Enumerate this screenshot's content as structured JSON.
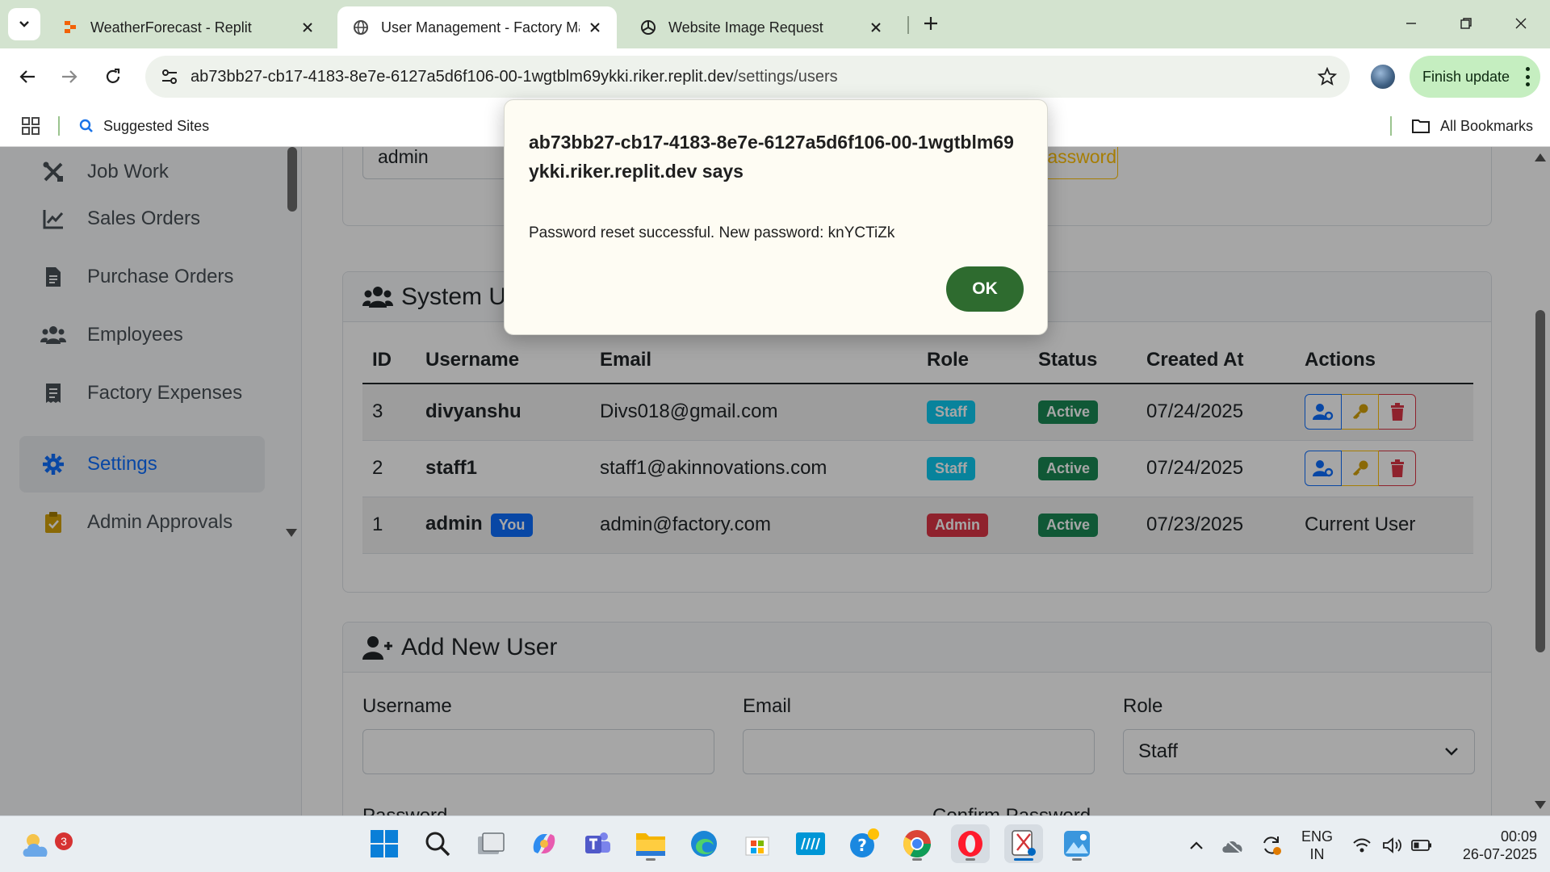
{
  "browser": {
    "tabs": [
      {
        "title": "WeatherForecast - Replit",
        "active": false
      },
      {
        "title": "User Management - Factory Ma",
        "active": true
      },
      {
        "title": "Website Image Request",
        "active": false
      }
    ],
    "url_host": "ab73bb27-cb17-4183-8e7e-6127a5d6f106-00-1wgtblm69ykki.riker.replit.dev",
    "url_path": "/settings/users",
    "finish_update_label": "Finish update",
    "bookmarks": {
      "suggested_sites": "Suggested Sites",
      "all_bookmarks": "All Bookmarks"
    }
  },
  "sidebar": {
    "items": [
      {
        "label": "Job Work",
        "icon": "tools-icon"
      },
      {
        "label": "Sales Orders",
        "icon": "chart-line-icon"
      },
      {
        "label": "Purchase Orders",
        "icon": "file-invoice-icon"
      },
      {
        "label": "Employees",
        "icon": "users-icon"
      },
      {
        "label": "Factory Expenses",
        "icon": "receipt-icon"
      },
      {
        "label": "Settings",
        "icon": "gear-icon",
        "active": true
      },
      {
        "label": "Admin Approvals",
        "icon": "clipboard-check-icon"
      }
    ]
  },
  "reset_card": {
    "username_value": "admin",
    "button_label": "Password"
  },
  "users_card": {
    "title": "System Users",
    "columns": [
      "ID",
      "Username",
      "Email",
      "Role",
      "Status",
      "Created At",
      "Actions"
    ],
    "rows": [
      {
        "id": "3",
        "username": "divyanshu",
        "email": "Divs018@gmail.com",
        "role": "Staff",
        "status": "Active",
        "created_at": "07/24/2025"
      },
      {
        "id": "2",
        "username": "staff1",
        "email": "staff1@akinnovations.com",
        "role": "Staff",
        "status": "Active",
        "created_at": "07/24/2025"
      },
      {
        "id": "1",
        "username": "admin",
        "you_badge": "You",
        "email": "admin@factory.com",
        "role": "Admin",
        "status": "Active",
        "created_at": "07/23/2025",
        "actions_text": "Current User"
      }
    ],
    "colors": {
      "staff": "#0dcaf0",
      "admin": "#dc3545",
      "active": "#198754"
    }
  },
  "add_user_card": {
    "title": "Add New User",
    "username_label": "Username",
    "email_label": "Email",
    "role_label": "Role",
    "role_selected": "Staff",
    "password_label": "Password",
    "confirm_password_label": "Confirm Password"
  },
  "dialog": {
    "origin": "ab73bb27-cb17-4183-8e7e-6127a5d6f106-00-1wgtblm69ykki.riker.replit.dev says",
    "message": "Password reset successful. New password: knYCTiZk",
    "ok_label": "OK"
  },
  "taskbar": {
    "weather_badge": "3",
    "lang_line1": "ENG",
    "lang_line2": "IN",
    "time": "00:09",
    "date": "26-07-2025"
  }
}
